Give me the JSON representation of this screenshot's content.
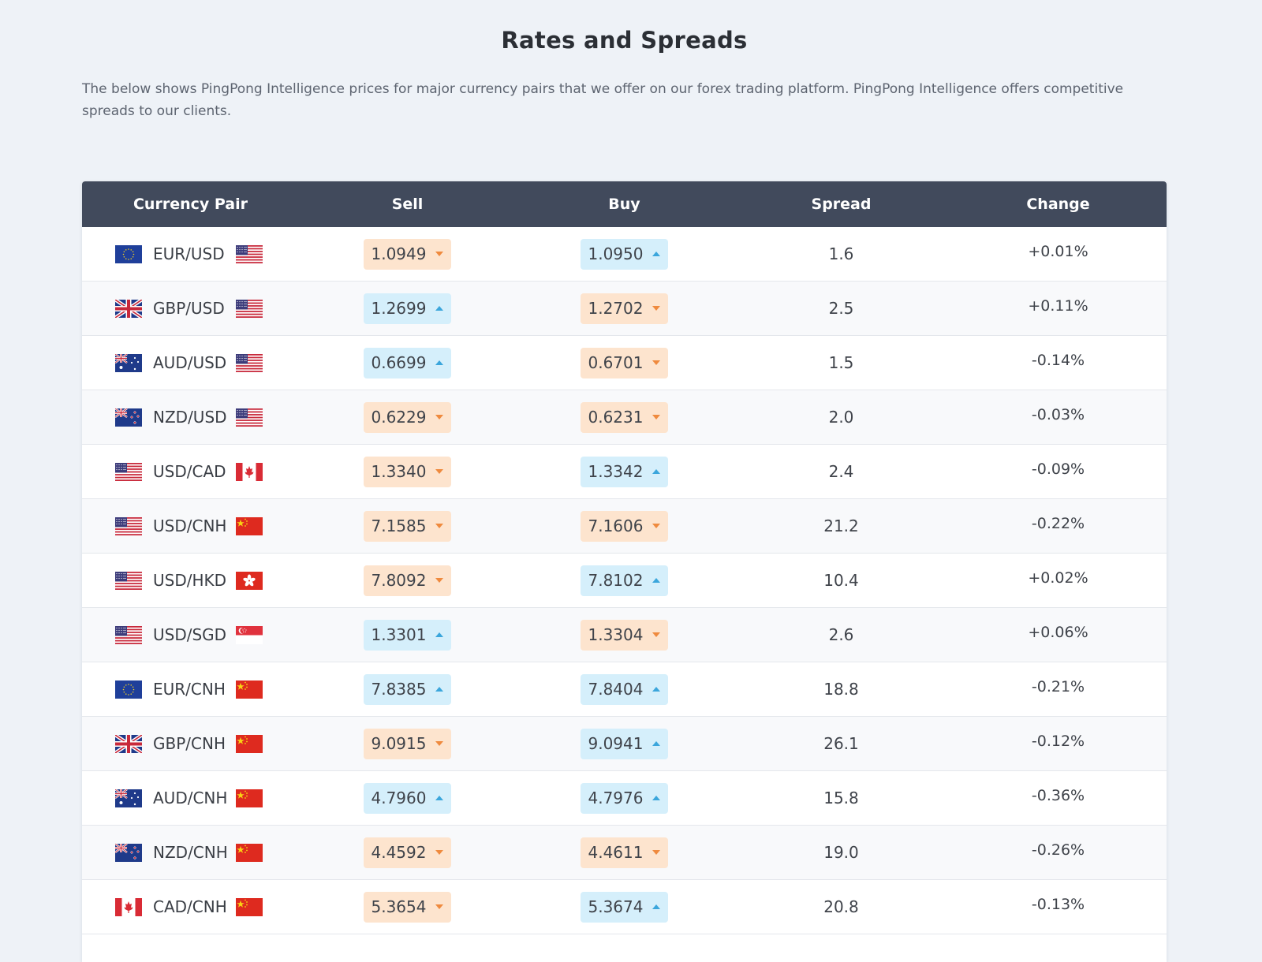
{
  "title": "Rates and Spreads",
  "intro": "The below shows PingPong Intelligence prices for major currency pairs that we offer on our forex trading platform. PingPong Intelligence offers competitive spreads to our clients.",
  "table": {
    "headers": [
      "Currency Pair",
      "Sell",
      "Buy",
      "Spread",
      "Change"
    ],
    "rows": [
      {
        "pair": "EUR/USD",
        "base": "eu",
        "quote": "us",
        "sell": "1.0949",
        "sell_dir": "down",
        "buy": "1.0950",
        "buy_dir": "up",
        "spread": "1.6",
        "change": "+0.01%"
      },
      {
        "pair": "GBP/USD",
        "base": "gb",
        "quote": "us",
        "sell": "1.2699",
        "sell_dir": "up",
        "buy": "1.2702",
        "buy_dir": "down",
        "spread": "2.5",
        "change": "+0.11%"
      },
      {
        "pair": "AUD/USD",
        "base": "au",
        "quote": "us",
        "sell": "0.6699",
        "sell_dir": "up",
        "buy": "0.6701",
        "buy_dir": "down",
        "spread": "1.5",
        "change": "-0.14%"
      },
      {
        "pair": "NZD/USD",
        "base": "nz",
        "quote": "us",
        "sell": "0.6229",
        "sell_dir": "down",
        "buy": "0.6231",
        "buy_dir": "down",
        "spread": "2.0",
        "change": "-0.03%"
      },
      {
        "pair": "USD/CAD",
        "base": "us",
        "quote": "ca",
        "sell": "1.3340",
        "sell_dir": "down",
        "buy": "1.3342",
        "buy_dir": "up",
        "spread": "2.4",
        "change": "-0.09%"
      },
      {
        "pair": "USD/CNH",
        "base": "us",
        "quote": "cn",
        "sell": "7.1585",
        "sell_dir": "down",
        "buy": "7.1606",
        "buy_dir": "down",
        "spread": "21.2",
        "change": "-0.22%"
      },
      {
        "pair": "USD/HKD",
        "base": "us",
        "quote": "hk",
        "sell": "7.8092",
        "sell_dir": "down",
        "buy": "7.8102",
        "buy_dir": "up",
        "spread": "10.4",
        "change": "+0.02%"
      },
      {
        "pair": "USD/SGD",
        "base": "us",
        "quote": "sg",
        "sell": "1.3301",
        "sell_dir": "up",
        "buy": "1.3304",
        "buy_dir": "down",
        "spread": "2.6",
        "change": "+0.06%"
      },
      {
        "pair": "EUR/CNH",
        "base": "eu",
        "quote": "cn",
        "sell": "7.8385",
        "sell_dir": "up",
        "buy": "7.8404",
        "buy_dir": "up",
        "spread": "18.8",
        "change": "-0.21%"
      },
      {
        "pair": "GBP/CNH",
        "base": "gb",
        "quote": "cn",
        "sell": "9.0915",
        "sell_dir": "down",
        "buy": "9.0941",
        "buy_dir": "up",
        "spread": "26.1",
        "change": "-0.12%"
      },
      {
        "pair": "AUD/CNH",
        "base": "au",
        "quote": "cn",
        "sell": "4.7960",
        "sell_dir": "up",
        "buy": "4.7976",
        "buy_dir": "up",
        "spread": "15.8",
        "change": "-0.36%"
      },
      {
        "pair": "NZD/CNH",
        "base": "nz",
        "quote": "cn",
        "sell": "4.4592",
        "sell_dir": "down",
        "buy": "4.4611",
        "buy_dir": "down",
        "spread": "19.0",
        "change": "-0.26%"
      },
      {
        "pair": "CAD/CNH",
        "base": "ca",
        "quote": "cn",
        "sell": "5.3654",
        "sell_dir": "down",
        "buy": "5.3674",
        "buy_dir": "up",
        "spread": "20.8",
        "change": "-0.13%"
      }
    ]
  },
  "colors": {
    "header_bg": "#414a5c",
    "sell_down_bg": "#fde4ce",
    "buy_up_bg": "#d5effb",
    "down_arrow": "#ef8a3e",
    "up_arrow": "#3ba6dc"
  }
}
